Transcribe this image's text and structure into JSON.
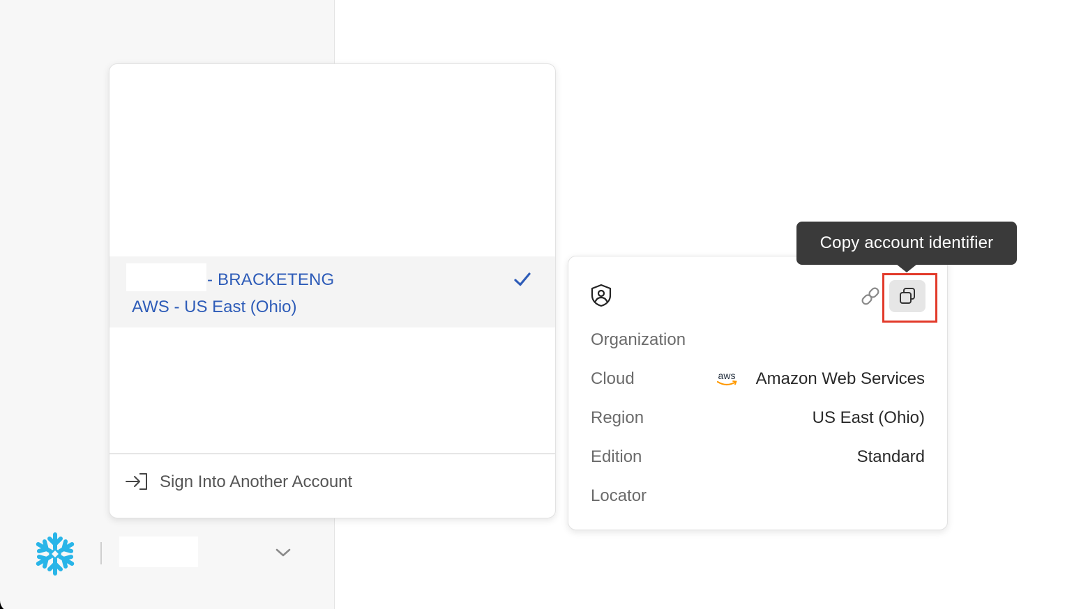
{
  "account_menu": {
    "selected_account": {
      "name": "- BRACKETENG",
      "region": "AWS - US East (Ohio)"
    },
    "sign_in_label": "Sign Into Another Account"
  },
  "account_details": {
    "rows": [
      {
        "label": "Organization",
        "value": ""
      },
      {
        "label": "Cloud",
        "value": "Amazon Web Services"
      },
      {
        "label": "Region",
        "value": "US East (Ohio)"
      },
      {
        "label": "Edition",
        "value": "Standard"
      },
      {
        "label": "Locator",
        "value": ""
      }
    ],
    "tooltip": "Copy account identifier"
  },
  "icons": {
    "logo": "snowflake-icon",
    "check": "check-icon",
    "sign_in": "sign-in-icon",
    "chevron": "chevron-down-icon",
    "shield": "shield-icon",
    "link": "link-icon",
    "copy": "copy-icon",
    "cloud_provider": "aws-icon"
  },
  "colors": {
    "accent": "#2e5cb8",
    "logo": "#29b5e8",
    "highlight": "#e23a2a",
    "tooltip_bg": "#3a3a3a"
  }
}
